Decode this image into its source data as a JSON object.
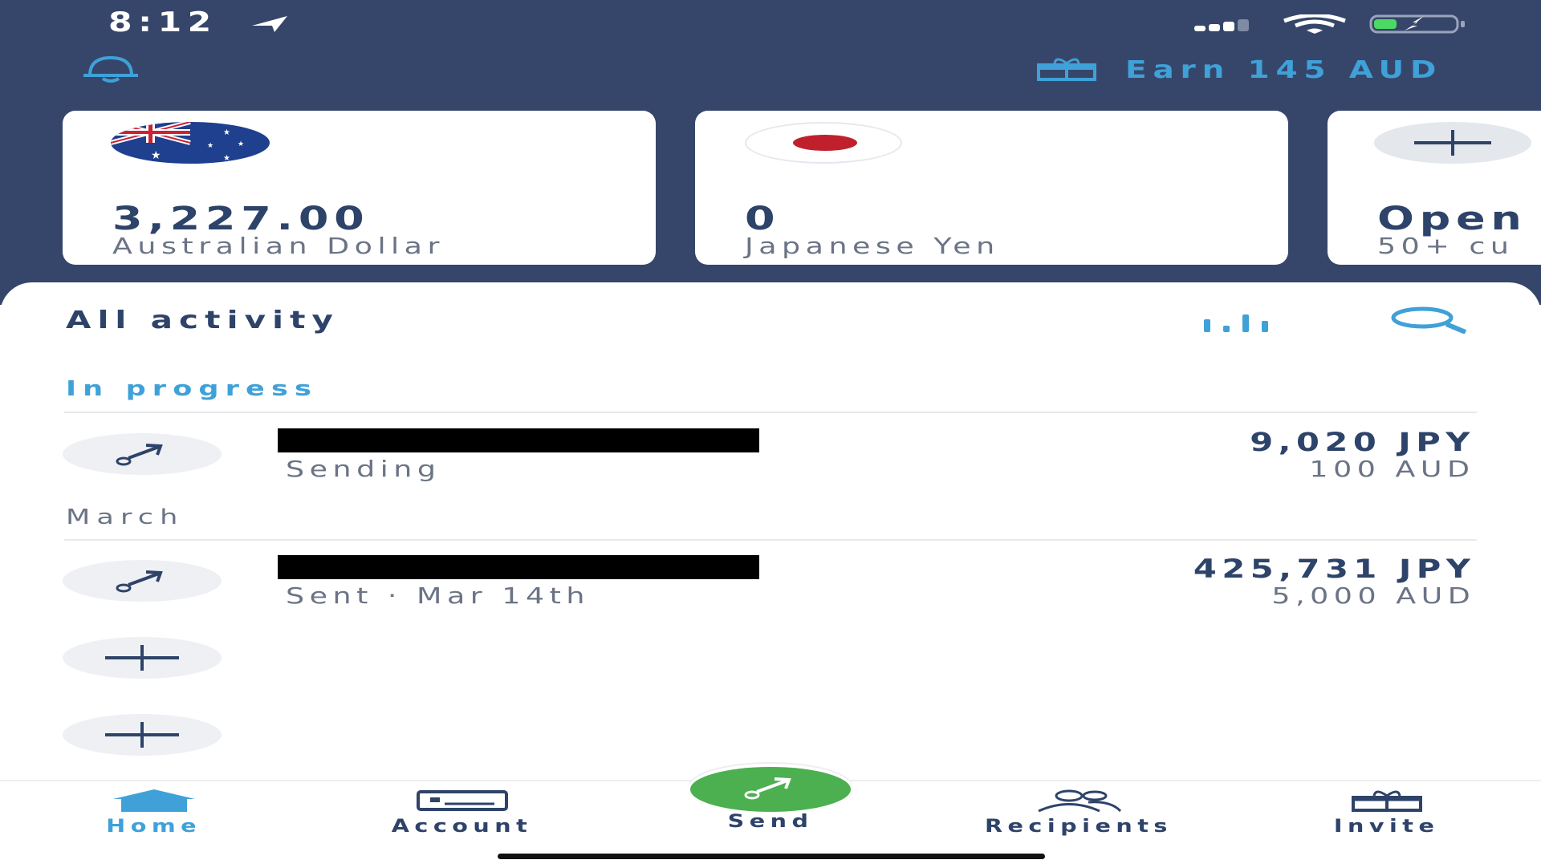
{
  "status_bar": {
    "time": "8:12"
  },
  "header": {
    "earn_label": "Earn 145 AUD"
  },
  "balances": [
    {
      "amount": "3,227.00",
      "currency_name": "Australian Dollar",
      "flag": "australia-flag"
    },
    {
      "amount": "0",
      "currency_name": "Japanese Yen",
      "flag": "japan-flag"
    },
    {
      "amount": "Open",
      "currency_name": "50+ cu",
      "flag": "plus-icon"
    }
  ],
  "activity": {
    "title": "All activity",
    "sections": [
      {
        "label": "In progress",
        "items": [
          {
            "status": "Sending",
            "amount": "9,020 JPY",
            "source": "100 AUD"
          }
        ]
      },
      {
        "label": "March",
        "items": [
          {
            "status": "Sent · Mar 14th",
            "amount": "425,731 JPY",
            "source": "5,000 AUD"
          }
        ]
      }
    ]
  },
  "nav": {
    "items": [
      {
        "label": "Home",
        "icon": "home-icon",
        "active": true
      },
      {
        "label": "Account",
        "icon": "account-card-icon"
      },
      {
        "label": "Send",
        "icon": "send-arrow-icon"
      },
      {
        "label": "Recipients",
        "icon": "recipients-icon"
      },
      {
        "label": "Invite",
        "icon": "gift-icon"
      }
    ]
  },
  "colors": {
    "header_bg": "#36466a",
    "accent": "#3fa1d8",
    "send_green": "#4caf50",
    "text_dark": "#2e4369",
    "text_muted": "#6b7486"
  }
}
